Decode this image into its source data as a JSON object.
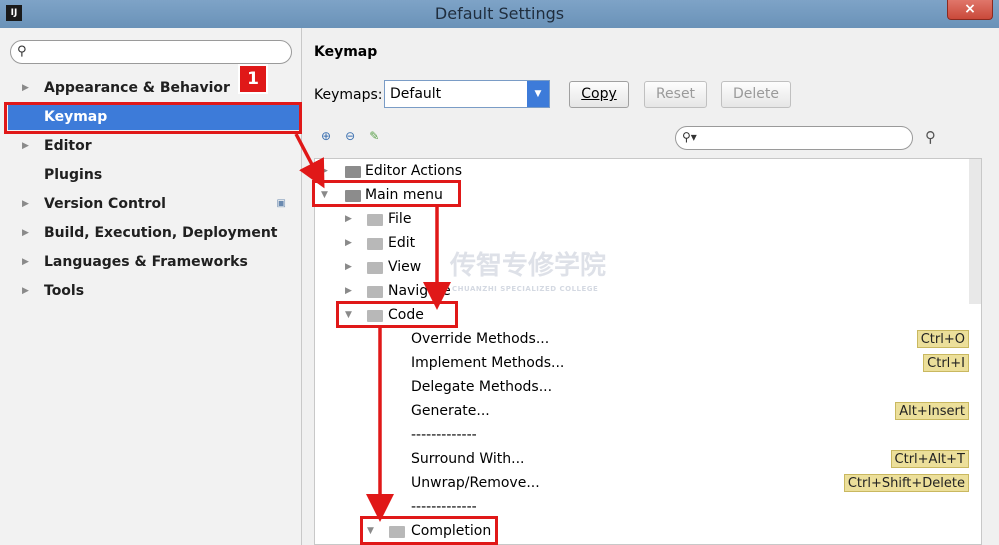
{
  "window": {
    "title": "Default Settings",
    "close_label": "×",
    "app_icon": "IJ"
  },
  "sidebar": {
    "search_placeholder": "",
    "items": [
      {
        "label": "Appearance & Behavior",
        "expandable": true
      },
      {
        "label": "Keymap",
        "expandable": false,
        "selected": true
      },
      {
        "label": "Editor",
        "expandable": true
      },
      {
        "label": "Plugins",
        "expandable": false
      },
      {
        "label": "Version Control",
        "expandable": true,
        "icon": "project-icon"
      },
      {
        "label": "Build, Execution, Deployment",
        "expandable": true
      },
      {
        "label": "Languages & Frameworks",
        "expandable": true
      },
      {
        "label": "Tools",
        "expandable": true
      }
    ]
  },
  "keymap": {
    "heading": "Keymap",
    "keymaps_label": "Keymaps:",
    "selected": "Default",
    "buttons": {
      "copy": "Copy",
      "reset": "Reset",
      "delete": "Delete"
    },
    "filter_placeholder": ""
  },
  "tree": [
    {
      "label": "Editor Actions",
      "level": 0,
      "state": "collapsed",
      "icon": "editor-actions-icon"
    },
    {
      "label": "Main menu",
      "level": 0,
      "state": "expanded",
      "icon": "main-menu-icon"
    },
    {
      "label": "File",
      "level": 1,
      "state": "collapsed"
    },
    {
      "label": "Edit",
      "level": 1,
      "state": "collapsed"
    },
    {
      "label": "View",
      "level": 1,
      "state": "collapsed"
    },
    {
      "label": "Navigate",
      "level": 1,
      "state": "collapsed"
    },
    {
      "label": "Code",
      "level": 1,
      "state": "expanded"
    },
    {
      "label": "Override Methods...",
      "level": 2,
      "shortcut": "Ctrl+O"
    },
    {
      "label": "Implement Methods...",
      "level": 2,
      "shortcut": "Ctrl+I"
    },
    {
      "label": "Delegate Methods...",
      "level": 2,
      "shortcut": ""
    },
    {
      "label": "Generate...",
      "level": 2,
      "shortcut": "Alt+Insert"
    },
    {
      "label": "-------------",
      "level": 2,
      "shortcut": ""
    },
    {
      "label": "Surround With...",
      "level": 2,
      "shortcut": "Ctrl+Alt+T"
    },
    {
      "label": "Unwrap/Remove...",
      "level": 2,
      "shortcut": "Ctrl+Shift+Delete"
    },
    {
      "label": "-------------",
      "level": 2,
      "shortcut": ""
    },
    {
      "label": "Completion",
      "level": 2,
      "state": "expanded"
    }
  ],
  "annotation": {
    "badge": "1",
    "color": "#e01818"
  },
  "watermark": {
    "text": "传智专修学院",
    "subtext": "CHUANZHI SPECIALIZED COLLEGE"
  },
  "colors": {
    "selection": "#3d7bd9",
    "shortcut_bg": "#ecdf9a"
  }
}
